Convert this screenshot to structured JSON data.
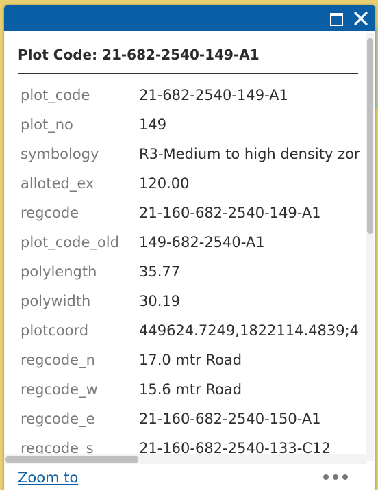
{
  "popup": {
    "title": "Plot Code: 21-682-2540-149-A1",
    "maximize_icon": "maximize-icon",
    "close_icon": "close-icon",
    "accent_color": "#0a5ea6"
  },
  "attributes": [
    {
      "key": "plot_code",
      "value": "21-682-2540-149-A1"
    },
    {
      "key": "plot_no",
      "value": "149"
    },
    {
      "key": "symbology",
      "value": "R3-Medium to high density zor"
    },
    {
      "key": "alloted_ex",
      "value": "120.00"
    },
    {
      "key": "regcode",
      "value": "21-160-682-2540-149-A1"
    },
    {
      "key": "plot_code_old",
      "value": "149-682-2540-A1"
    },
    {
      "key": "polylength",
      "value": "35.77"
    },
    {
      "key": "polywidth",
      "value": "30.19"
    },
    {
      "key": "plotcoord",
      "value": "449624.7249,1822114.4839;4"
    },
    {
      "key": "regcode_n",
      "value": "17.0 mtr Road"
    },
    {
      "key": "regcode_w",
      "value": "15.6 mtr Road"
    },
    {
      "key": "regcode_e",
      "value": "21-160-682-2540-150-A1"
    },
    {
      "key": "regcode_s",
      "value": "21-160-682-2540-133-C12"
    }
  ],
  "footer": {
    "zoom_label": "Zoom to",
    "more_icon": "more-options-icon"
  }
}
